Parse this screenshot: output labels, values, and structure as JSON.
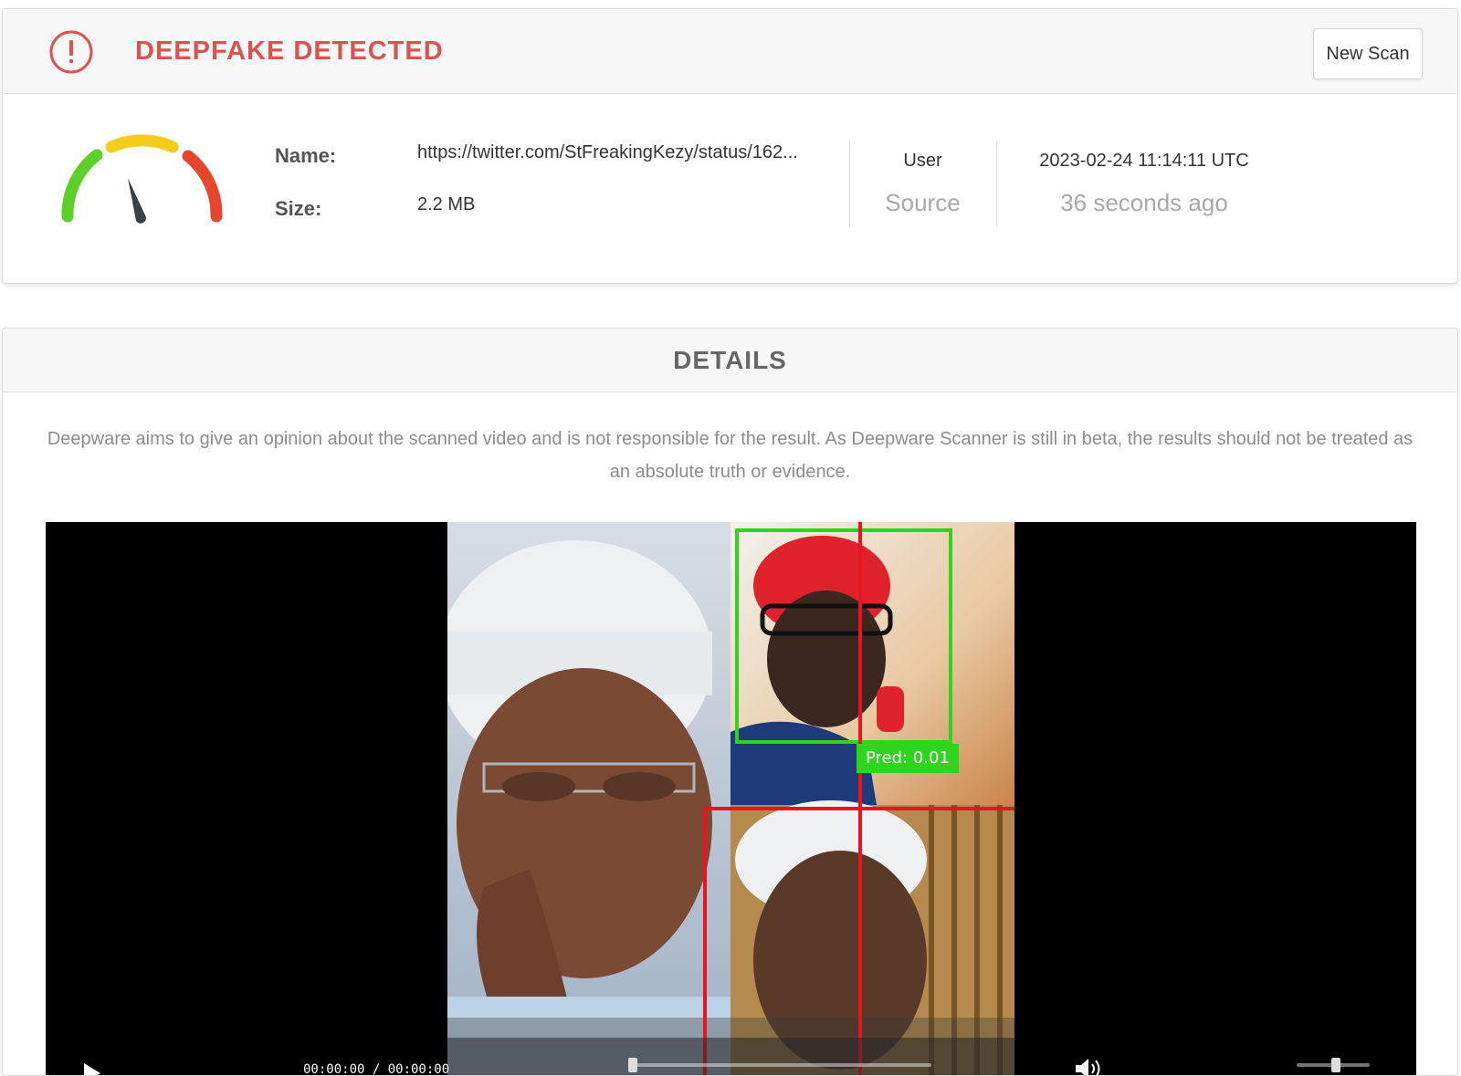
{
  "result": {
    "verdict": "DEEPFAKE DETECTED",
    "new_scan_label": "New Scan",
    "name_label": "Name:",
    "name_value": "https://twitter.com/StFreakingKezy/status/162...",
    "size_label": "Size:",
    "size_value": "2.2 MB",
    "source_top": "User",
    "source_bottom": "Source",
    "timestamp": "2023-02-24 11:14:11 UTC",
    "time_ago": "36 seconds ago",
    "gauge_colors": [
      "#5ccf29",
      "#f4cd1c",
      "#e7462e"
    ],
    "alert_color": "#d9534f",
    "icons": {
      "alert": "exclamation-circle-icon",
      "gauge": "risk-gauge-icon"
    }
  },
  "details": {
    "title": "DETAILS",
    "disclaimer": "Deepware aims to give an opinion about the scanned video and is not responsible for the result. As Deepware Scanner is still in beta, the results should not be treated as an absolute truth or evidence.",
    "video": {
      "prediction_label": "Pred: 0.01",
      "time_display": "00:00:00 / 00:00:00",
      "box_colors": {
        "real": "#2fd51d",
        "fake": "#e8151e"
      },
      "icons": {
        "play": "play-icon",
        "volume": "volume-icon"
      }
    }
  }
}
